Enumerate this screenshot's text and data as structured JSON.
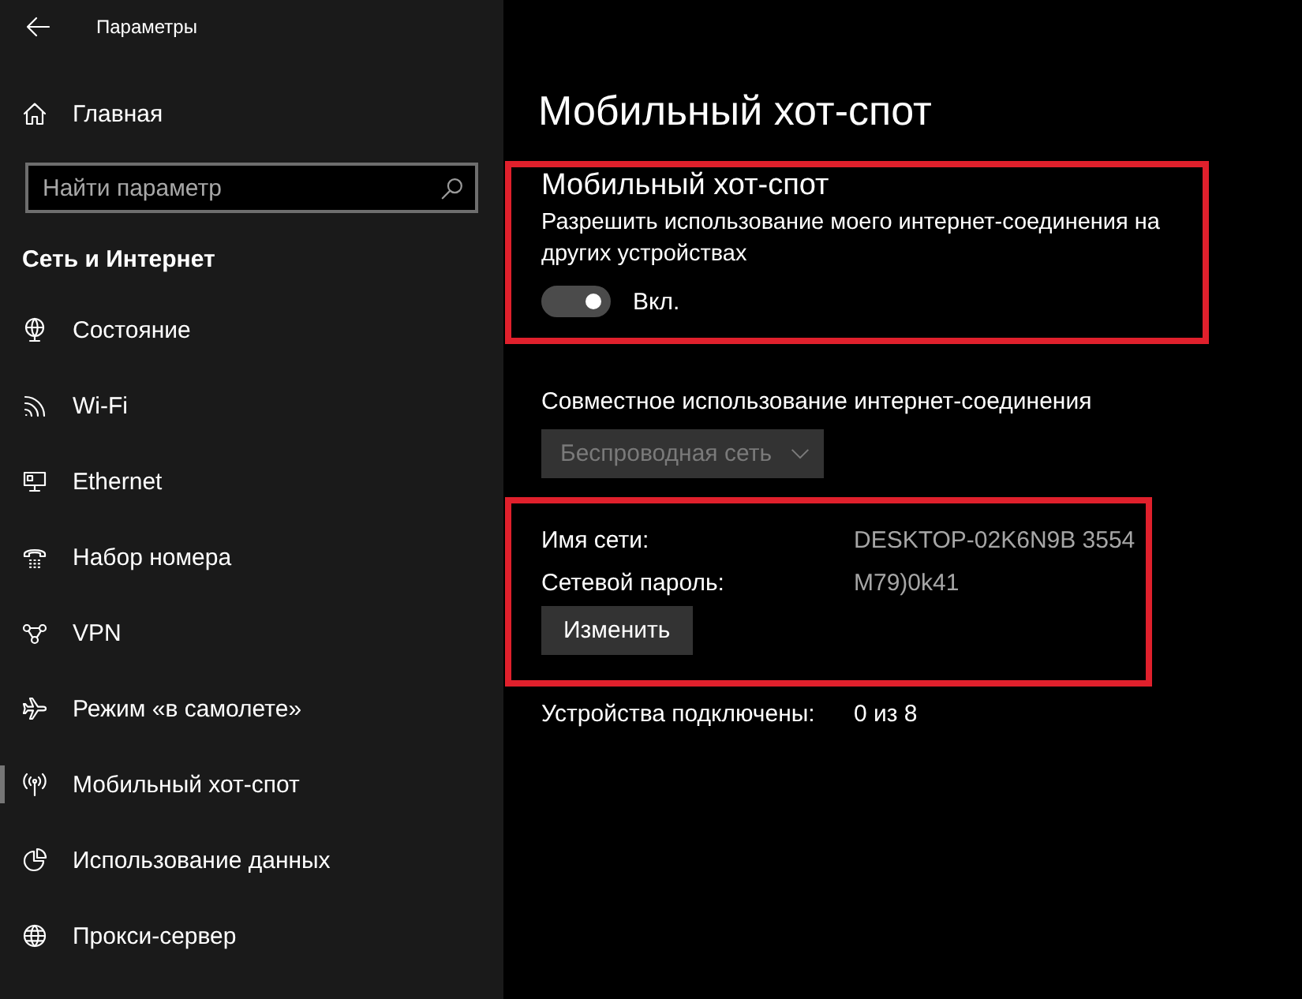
{
  "window": {
    "title": "Параметры"
  },
  "sidebar": {
    "home": {
      "label": "Главная"
    },
    "search": {
      "placeholder": "Найти параметр"
    },
    "category": "Сеть и Интернет",
    "items": [
      {
        "label": "Состояние",
        "selected": false
      },
      {
        "label": "Wi-Fi",
        "selected": false
      },
      {
        "label": "Ethernet",
        "selected": false
      },
      {
        "label": "Набор номера",
        "selected": false
      },
      {
        "label": "VPN",
        "selected": false
      },
      {
        "label": "Режим «в самолете»",
        "selected": false
      },
      {
        "label": "Мобильный хот-спот",
        "selected": true
      },
      {
        "label": "Использование данных",
        "selected": false
      },
      {
        "label": "Прокси-сервер",
        "selected": false
      }
    ]
  },
  "page": {
    "title": "Мобильный хот-спот",
    "hotspot": {
      "highlighted": true,
      "heading": "Мобильный хот-спот",
      "description": "Разрешить использование моего интернет-соединения на других устройствах",
      "toggle": {
        "on": true,
        "label": "Вкл."
      }
    },
    "sharing": {
      "label": "Совместное использование интернет-соединения",
      "dropdown": {
        "value": "Беспроводная сеть",
        "disabled": true
      }
    },
    "network": {
      "highlighted": true,
      "fields": [
        {
          "label": "Имя сети:",
          "value": "DESKTOP-02K6N9B 3554"
        },
        {
          "label": "Сетевой пароль:",
          "value": "M79)0k41"
        }
      ],
      "button": "Изменить"
    },
    "devices": {
      "label": "Устройства подключены:",
      "value": "0 из 8"
    }
  }
}
